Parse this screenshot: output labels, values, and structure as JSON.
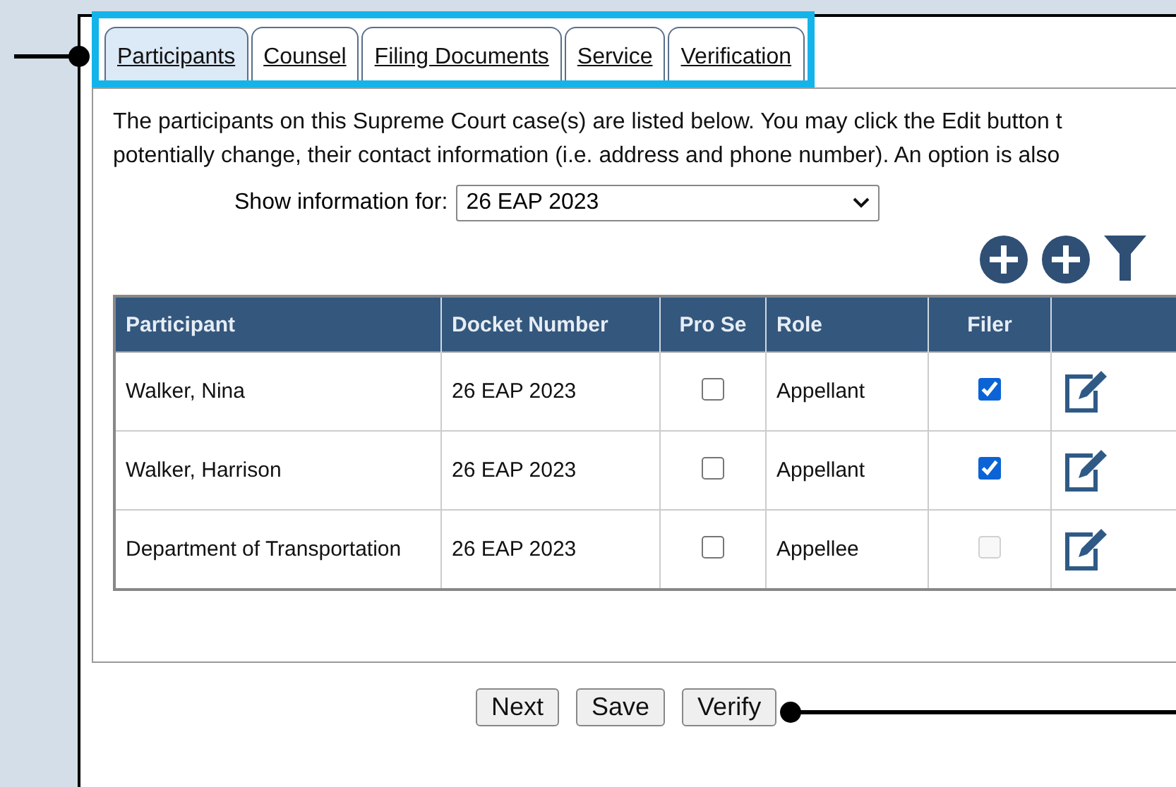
{
  "tabs": [
    {
      "label": "Participants",
      "selected": true
    },
    {
      "label": "Counsel",
      "selected": false
    },
    {
      "label": "Filing Documents",
      "selected": false
    },
    {
      "label": "Service",
      "selected": false
    },
    {
      "label": "Verification",
      "selected": false
    }
  ],
  "intro": [
    "The participants on this Supreme Court case(s) are listed below. You may click the Edit button t",
    "potentially change, their contact information (i.e. address and phone number). An option is also"
  ],
  "show_for": {
    "label": "Show information for:",
    "value": "26 EAP 2023"
  },
  "table": {
    "columns": [
      "Participant",
      "Docket Number",
      "Pro Se",
      "Role",
      "Filer"
    ],
    "rows": [
      {
        "participant": "Walker, Nina",
        "docket": "26 EAP 2023",
        "pro_se": false,
        "role": "Appellant",
        "filer": true,
        "filer_disabled": false
      },
      {
        "participant": "Walker, Harrison",
        "docket": "26 EAP 2023",
        "pro_se": false,
        "role": "Appellant",
        "filer": true,
        "filer_disabled": false
      },
      {
        "participant": "Department of Transportation",
        "docket": "26 EAP 2023",
        "pro_se": false,
        "role": "Appellee",
        "filer": false,
        "filer_disabled": true
      }
    ]
  },
  "buttons": [
    "Next",
    "Save",
    "Verify"
  ]
}
